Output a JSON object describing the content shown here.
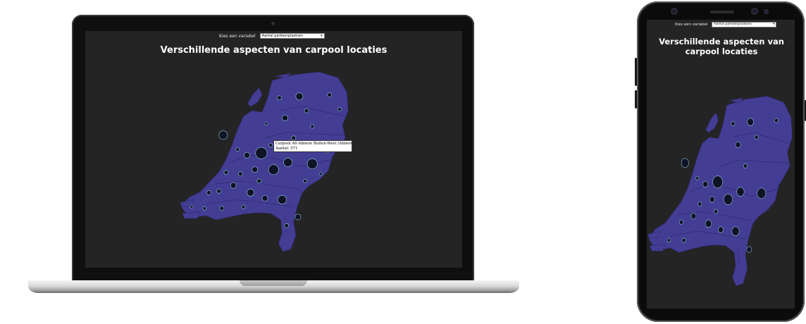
{
  "app": {
    "control_label": "Kies een variabel",
    "select_value": "Aantal parkeerplaatsen",
    "title": "Verschillende aspecten van carpool locaties"
  },
  "tooltip": {
    "name": "Carpool A6-Almere Buiten-West (Almere)",
    "value_line": "Aantal: 571"
  },
  "colors": {
    "screen_background": "#242424",
    "map_fill": "#433d94",
    "province_border": "#2f2a70",
    "bubble_fill": "#0f1326",
    "bubble_stroke": "#8ec8d8",
    "title_text": "#ffffff"
  },
  "icons": {
    "select_arrow": "chevron-down-icon",
    "camera": "camera-icon"
  }
}
